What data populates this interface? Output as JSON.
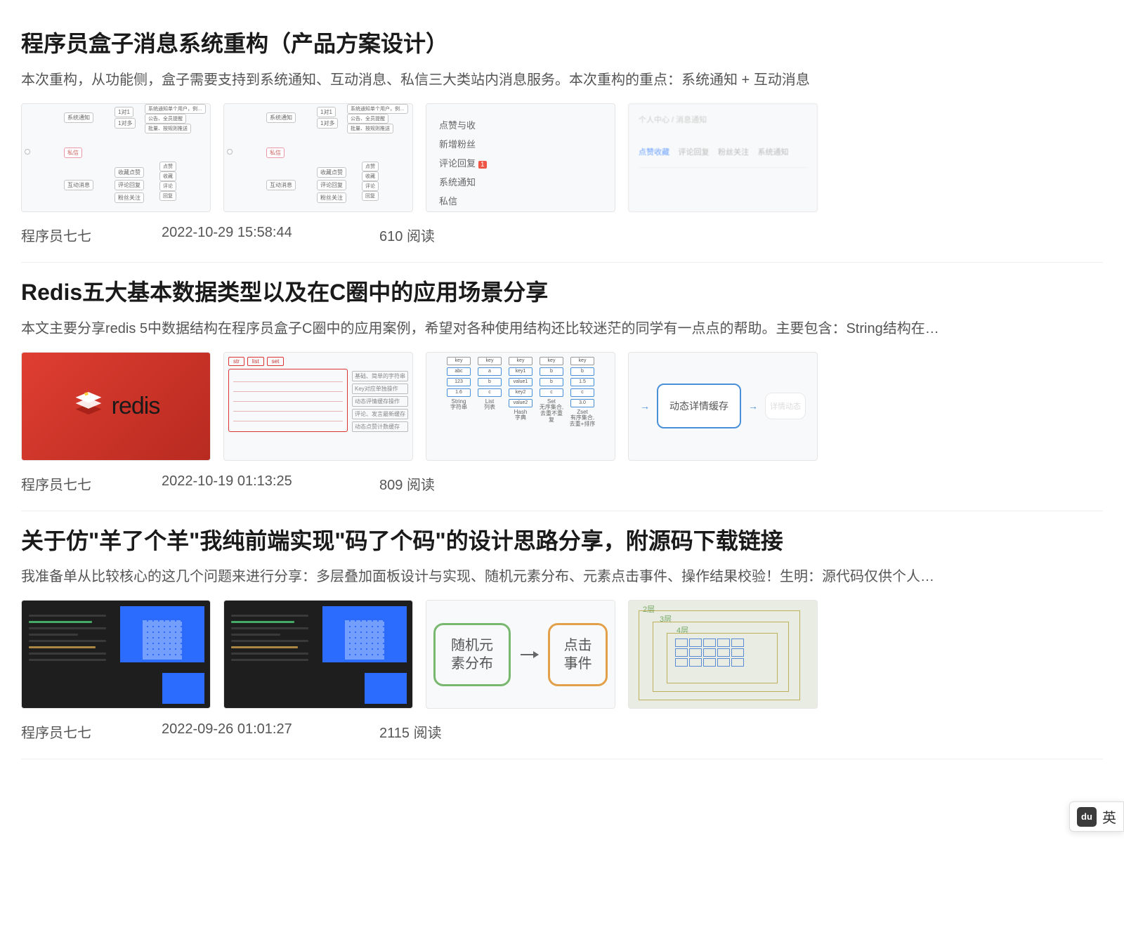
{
  "widget": {
    "icon_label": "du",
    "lang_label": "英"
  },
  "reads_suffix": "阅读",
  "articles": [
    {
      "title": "程序员盒子消息系统重构（产品方案设计）",
      "summary": "本次重构，从功能侧，盒子需要支持到系统通知、互动消息、私信三大类站内消息服务。本次重构的重点：系统通知 + 互动消息",
      "author": "程序员七七",
      "date": "2022-10-29 15:58:44",
      "reads": "610",
      "thumbs": {
        "mindmap": {
          "root_branches": [
            "系统通知",
            "私信",
            "互动消息"
          ],
          "sys_children": [
            "1对1",
            "1对多"
          ],
          "sys_leaf": [
            "系统通知单个用户，例…",
            "公告、全员提醒",
            "批量、按规则推送"
          ],
          "react_children": [
            "收藏点赞",
            "评论回复",
            "粉丝关注"
          ],
          "react_leaf": [
            "点赞",
            "收藏",
            "评论",
            "回复"
          ]
        },
        "menu": [
          "点赞与收",
          "新增粉丝",
          "评论回复",
          "系统通知",
          "私信"
        ],
        "menu_badge": "1",
        "faint_header": "个人中心 / 消息通知",
        "faint_tabs": [
          "点赞收藏",
          "评论回复",
          "粉丝关注",
          "系统通知"
        ]
      }
    },
    {
      "title": "Redis五大基本数据类型以及在C圈中的应用场景分享",
      "summary": "本文主要分享redis 5中数据结构在程序员盒子C圈中的应用案例，希望对各种使用结构还比较迷茫的同学有一点点的帮助。主要包含：String结构在…",
      "author": "程序员七七",
      "date": "2022-10-19 01:13:25",
      "reads": "809",
      "thumbs": {
        "logo_text": "redis",
        "outline_tabs": [
          "str",
          "list",
          "set"
        ],
        "outline_side": [
          "基础、简单的字符串",
          "Key对应单独操作",
          "动态评情缓存操作",
          "评论、发言最新缓存",
          "动态点赞计数缓存"
        ],
        "ds": {
          "columns": [
            "String",
            "List",
            "Hash",
            "Set",
            "Zset"
          ],
          "sub": [
            "字符串",
            "列表",
            "字典",
            "无序集合,去重不重复",
            "有序集合,去重+排序"
          ],
          "headers": [
            "key",
            "key",
            "key",
            "key",
            "key"
          ],
          "rows": [
            [
              "abc",
              "a",
              "key1",
              "b",
              "b"
            ],
            [
              "123",
              "b",
              "value1",
              "b",
              "1.5"
            ],
            [
              "1.6",
              "c",
              "key2",
              "c",
              "c"
            ],
            [
              "",
              "",
              "value2",
              "",
              "3.0"
            ]
          ]
        },
        "flow_main": "动态详情缓存",
        "flow_faint": "详情动态"
      }
    },
    {
      "title": "关于仿\"羊了个羊\"我纯前端实现\"码了个码\"的设计思路分享，附源码下载链接",
      "summary": "我准备单从比较核心的这几个问题来进行分享：多层叠加面板设计与实现、随机元素分布、元素点击事件、操作结果校验！生明：源代码仅供个人…",
      "author": "程序员七七",
      "date": "2022-09-26 01:01:27",
      "reads": "2115",
      "thumbs": {
        "step1": "随机元素分布",
        "step2": "点击事件",
        "layers": [
          "2层",
          "3层",
          "4层"
        ]
      }
    }
  ]
}
